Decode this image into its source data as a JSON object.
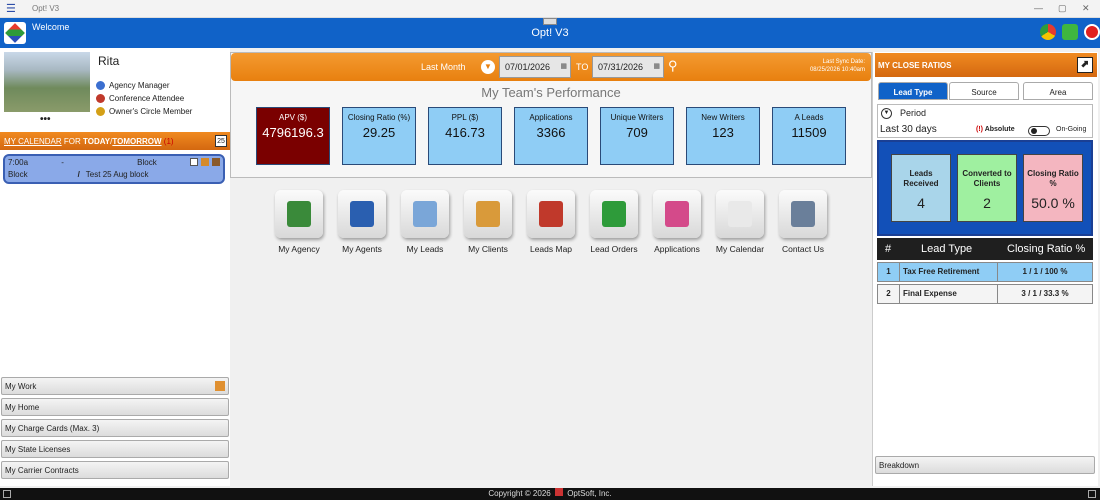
{
  "window": {
    "title": "Opt! V3"
  },
  "header": {
    "welcome": "Welcome",
    "title": "Opt! V3"
  },
  "profile": {
    "name": "Rita",
    "more": "•••",
    "roles": [
      "Agency Manager",
      "Conference Attendee",
      "Owner's Circle Member"
    ]
  },
  "calendar": {
    "prefix": "MY CALENDAR",
    "for": " FOR ",
    "today": "TODAY",
    "slash": "/",
    "tomorrow": "TOMORROW",
    "count": "(1)",
    "icon_text": "25",
    "entry": {
      "time": "7:00a",
      "dash": "-",
      "type": "Block",
      "line2_left": "Block",
      "line2_sep": "/",
      "line2_right": "Test 25 Aug block"
    }
  },
  "side_menu": [
    "My Work",
    "My Home",
    "My Charge Cards (Max. 3)",
    "My State Licenses",
    "My Carrier Contracts"
  ],
  "filter": {
    "period_label": "Last Month",
    "from_date": "07/01/2026",
    "to_label": "TO",
    "to_date": "07/31/2026",
    "sync_label": "Last Sync Date:",
    "sync_value": "08/25/2026 10:40am"
  },
  "performance": {
    "title": "My Team's Performance",
    "kpis": [
      {
        "label": "APV ($)",
        "value": "4796196.3",
        "color": "#7a0000",
        "text": "#ffffff"
      },
      {
        "label": "Closing Ratio (%)",
        "value": "29.25",
        "color": "#8fcdf5",
        "text": "#111111"
      },
      {
        "label": "PPL ($)",
        "value": "416.73",
        "color": "#8fcdf5",
        "text": "#111111"
      },
      {
        "label": "Applications",
        "value": "3366",
        "color": "#8fcdf5",
        "text": "#111111"
      },
      {
        "label": "Unique Writers",
        "value": "709",
        "color": "#8fcdf5",
        "text": "#111111"
      },
      {
        "label": "New Writers",
        "value": "123",
        "color": "#8fcdf5",
        "text": "#111111"
      },
      {
        "label": "A Leads",
        "value": "11509",
        "color": "#8fcdf5",
        "text": "#111111"
      }
    ]
  },
  "launcher": [
    {
      "label": "My Agency",
      "icon": "building-icon"
    },
    {
      "label": "My Agents",
      "icon": "agent-icon"
    },
    {
      "label": "My Leads",
      "icon": "leads-icon"
    },
    {
      "label": "My Clients",
      "icon": "clients-icon"
    },
    {
      "label": "Leads Map",
      "icon": "map-icon"
    },
    {
      "label": "Lead Orders",
      "icon": "dollar-icon"
    },
    {
      "label": "Applications",
      "icon": "application-icon"
    },
    {
      "label": "My Calendar",
      "icon": "calendar-icon"
    },
    {
      "label": "Contact Us",
      "icon": "phone-icon"
    }
  ],
  "close_ratios": {
    "title": "MY CLOSE RATIOS",
    "tabs": [
      "Lead Type",
      "Source",
      "Area"
    ],
    "period_label": "Period",
    "period_value": "Last 30 days",
    "absolute": "Absolute",
    "ongoing": "On-Going",
    "boxes": [
      {
        "label": "Leads Received",
        "value": "4",
        "color": "#a9d5ea"
      },
      {
        "label": "Converted to Clients",
        "value": "2",
        "color": "#9ff0a0"
      },
      {
        "label": "Closing Ratio %",
        "value": "50.0 %",
        "color": "#f4b6c0"
      }
    ],
    "table_headers": [
      "#",
      "Lead Type",
      "Closing Ratio %"
    ],
    "rows": [
      {
        "num": "1",
        "type": "Tax Free Retirement",
        "ratio": "1 / 1 / 100 %"
      },
      {
        "num": "2",
        "type": "Final Expense",
        "ratio": "3 / 1 / 33.3 %"
      }
    ],
    "breakdown": "Breakdown"
  },
  "footer": {
    "copyright": "Copyright © 2026",
    "company": "OptSoft, Inc."
  }
}
